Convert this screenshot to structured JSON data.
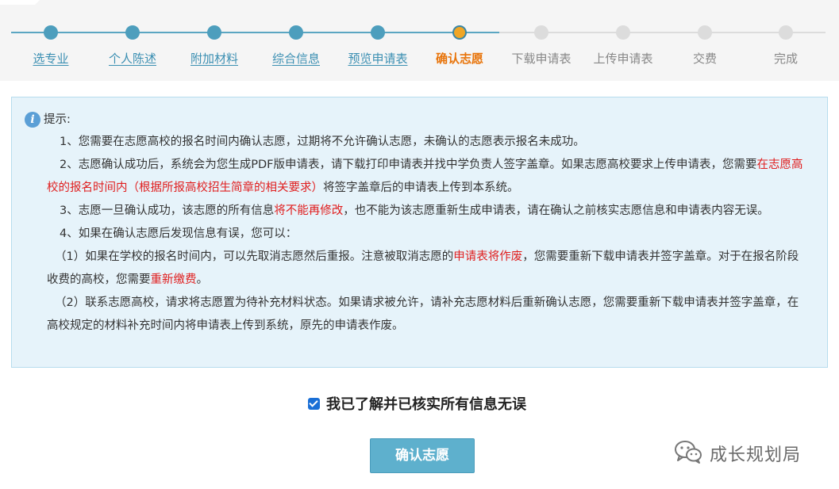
{
  "steps": [
    {
      "label": "选专业",
      "state": "done"
    },
    {
      "label": "个人陈述",
      "state": "done"
    },
    {
      "label": "附加材料",
      "state": "done"
    },
    {
      "label": "综合信息",
      "state": "done"
    },
    {
      "label": "预览申请表",
      "state": "done"
    },
    {
      "label": "确认志愿",
      "state": "current"
    },
    {
      "label": "下载申请表",
      "state": "todo"
    },
    {
      "label": "上传申请表",
      "state": "todo"
    },
    {
      "label": "交费",
      "state": "todo"
    },
    {
      "label": "完成",
      "state": "todo"
    }
  ],
  "notice": {
    "icon": "info-icon",
    "icon_glyph": "i",
    "title": "提示:",
    "p1": "1、您需要在志愿高校的报名时间内确认志愿，过期将不允许确认志愿，未确认的志愿表示报名未成功。",
    "p2_a": "2、志愿确认成功后，系统会为您生成PDF版申请表，请下载打印申请表并找中学负责人签字盖章。如果志愿高校要求上传申请表，您需要",
    "p2_red": "在志愿高校的报名时间内（根据所报高校招生简章的相关要求）",
    "p2_b": "将签字盖章后的申请表上传到本系统。",
    "p3_a": "3、志愿一旦确认成功，该志愿的所有信息",
    "p3_red": "将不能再修改",
    "p3_b": "，也不能为该志愿重新生成申请表，请在确认之前核实志愿信息和申请表内容无误。",
    "p4": "4、如果在确认志愿后发现信息有误，您可以：",
    "p5_a": "（1）如果在学校的报名时间内，可以先取消志愿然后重报。注意被取消志愿的",
    "p5_red": "申请表将作废",
    "p5_b": "，您需要重新下载申请表并签字盖章。对于在报名阶段收费的高校，您需要",
    "p5_red2": "重新缴费",
    "p5_c": "。",
    "p6": "（2）联系志愿高校，请求将志愿置为待补充材料状态。如果请求被允许，请补充志愿材料后重新确认志愿，您需要重新下载申请表并签字盖章，在高校规定的材料补充时间内将申请表上传到系统，原先的申请表作废。"
  },
  "agreement": {
    "checked": true,
    "label": "我已了解并已核实所有信息无误"
  },
  "confirm_button": {
    "label": "确认志愿"
  },
  "watermark": {
    "icon": "wechat-icon",
    "text": "成长规划局"
  },
  "colors": {
    "step_done": "#4d9ebd",
    "step_current": "#f0a626",
    "step_current_label": "#e8740a",
    "step_todo": "#dcdcdc",
    "notice_bg": "#e6f3fa",
    "highlight_red": "#e01e1e",
    "button_bg": "#5eb0cd"
  }
}
